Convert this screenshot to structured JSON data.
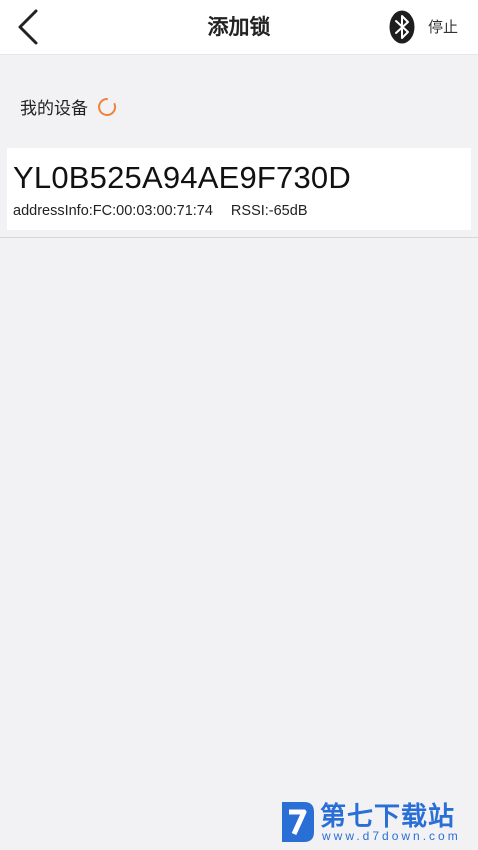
{
  "header": {
    "title": "添加锁",
    "stop_label": "停止"
  },
  "section": {
    "label": "我的设备"
  },
  "devices": [
    {
      "name": "YL0B525A94AE9F730D",
      "address": "addressInfo:FC:00:03:00:71:74",
      "rssi": "RSSI:-65dB"
    }
  ],
  "icons": {
    "back": "chevron-left-icon",
    "bluetooth": "bluetooth-icon",
    "loading": "loading-spinner-icon"
  },
  "colors": {
    "background": "#f2f2f4",
    "spinner": "#f0813a",
    "watermark": "#2a6fd6"
  },
  "watermark": {
    "text": "第七下载站",
    "url": "www.d7down.com"
  }
}
